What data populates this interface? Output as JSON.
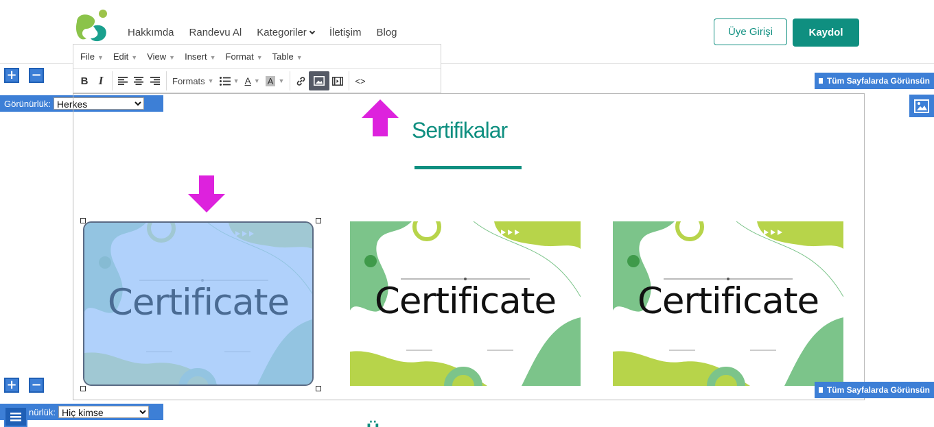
{
  "header": {
    "nav": [
      "Hakkımda",
      "Randevu Al",
      "Kategoriler",
      "İletişim",
      "Blog"
    ],
    "login_label": "Üye Girişi",
    "signup_label": "Kaydol",
    "brand_color": "#0f8f80"
  },
  "editor": {
    "menus": [
      "File",
      "Edit",
      "View",
      "Insert",
      "Format",
      "Table"
    ],
    "toolbar": {
      "bold": "B",
      "italic": "I",
      "formats_label": "Formats",
      "text_color": "A",
      "bg_color": "A",
      "code": "<>",
      "icons": [
        "align-left-icon",
        "align-center-icon",
        "align-right-icon",
        "bullet-list-icon",
        "link-icon",
        "image-icon",
        "media-icon"
      ]
    }
  },
  "sections": {
    "visibility_label": "Görünürlük:",
    "visibility_label_bottom": "nürlük:",
    "visibility_options_top": [
      "Herkes"
    ],
    "visibility_options_bottom": [
      "Hiç kimse"
    ],
    "all_pages_label": "Tüm Sayfalarda Görünsün",
    "plus": "+",
    "minus": "−"
  },
  "content": {
    "title": "Sertifikalar",
    "cards": [
      {
        "text": "Certificate",
        "selected": true
      },
      {
        "text": "Certificate",
        "selected": false
      },
      {
        "text": "Certificate",
        "selected": false
      }
    ],
    "next_title_fragment": "Ü"
  },
  "colors": {
    "accent_blue": "#3d7fd6",
    "highlight_arrow": "#dd22dd",
    "cert_green": "#7cc48a",
    "cert_lime": "#b7d44a"
  }
}
